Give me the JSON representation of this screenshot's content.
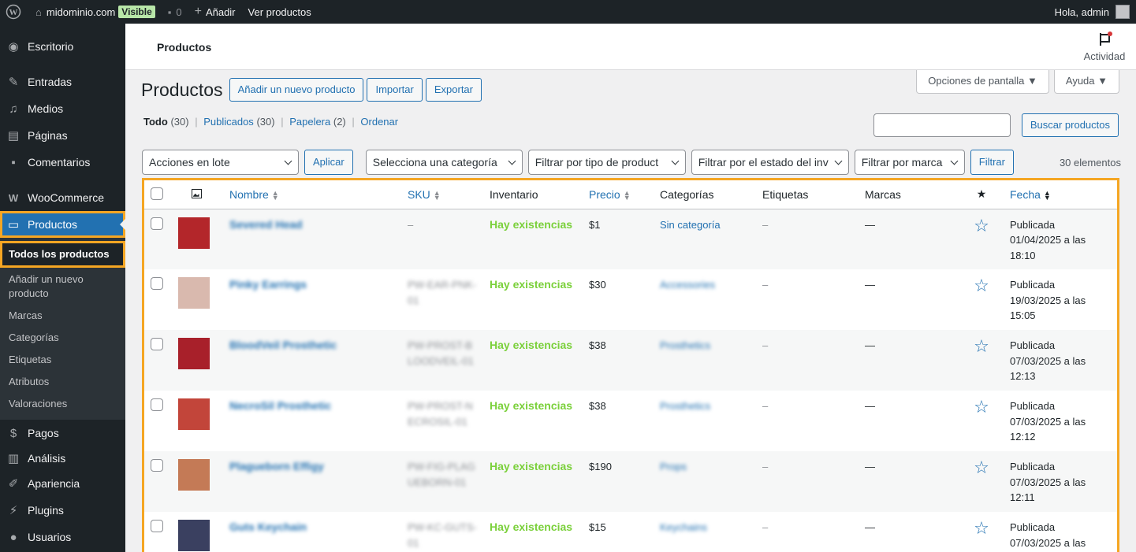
{
  "adminbar": {
    "site": "midominio.com",
    "visibility": "Visible",
    "comments_count": "0",
    "add_new": "Añadir",
    "view_products": "Ver productos",
    "greeting": "Hola, admin"
  },
  "sidebar": {
    "items": [
      {
        "label": "Escritorio",
        "icon": "dashboard-icon"
      },
      {
        "label": "Entradas",
        "icon": "pin-icon"
      },
      {
        "label": "Medios",
        "icon": "media-icon"
      },
      {
        "label": "Páginas",
        "icon": "page-icon"
      },
      {
        "label": "Comentarios",
        "icon": "comment-icon"
      },
      {
        "label": "WooCommerce",
        "icon": "woo-icon"
      },
      {
        "label": "Productos",
        "icon": "archive-icon"
      }
    ],
    "submenu": [
      "Todos los productos",
      "Añadir un nuevo producto",
      "Marcas",
      "Categorías",
      "Etiquetas",
      "Atributos",
      "Valoraciones"
    ],
    "bottom_items": [
      {
        "label": "Pagos",
        "icon": "payments-icon"
      },
      {
        "label": "Análisis",
        "icon": "chart-icon"
      },
      {
        "label": "Apariencia",
        "icon": "brush-icon"
      },
      {
        "label": "Plugins",
        "icon": "plug-icon"
      },
      {
        "label": "Usuarios",
        "icon": "user-icon"
      }
    ]
  },
  "header": {
    "title": "Productos",
    "activity": "Actividad"
  },
  "page": {
    "title": "Productos",
    "buttons": [
      "Añadir un nuevo producto",
      "Importar",
      "Exportar"
    ],
    "screen_options": "Opciones de pantalla ▼",
    "help": "Ayuda ▼",
    "views": {
      "all": "Todo",
      "all_count": "(30)",
      "published": "Publicados",
      "published_count": "(30)",
      "trash": "Papelera",
      "trash_count": "(2)",
      "sort": "Ordenar"
    },
    "search_button": "Buscar productos",
    "bulk_actions": "Acciones en lote",
    "apply": "Aplicar",
    "filters": [
      "Selecciona una categoría",
      "Filtrar por tipo de product",
      "Filtrar por el estado del inv",
      "Filtrar por marca"
    ],
    "filter_button": "Filtrar",
    "items_count": "30 elementos"
  },
  "table": {
    "columns": {
      "name": "Nombre",
      "sku": "SKU",
      "inventory": "Inventario",
      "price": "Precio",
      "categories": "Categorías",
      "tags": "Etiquetas",
      "brands": "Marcas",
      "date": "Fecha"
    },
    "rows": [
      {
        "name": "Severed Head",
        "sku": "–",
        "stock": "Hay existencias",
        "price": "$1",
        "category": "Sin categoría",
        "tags": "–",
        "brands": "—",
        "status": "Publicada",
        "date": "01/04/2025 a las",
        "time": "18:10",
        "thumb": "#b3262a"
      },
      {
        "name": "Pinky Earrings",
        "sku": "PW-EAR-PNK-01",
        "stock": "Hay existencias",
        "price": "$30",
        "category": "Accessories",
        "tags": "–",
        "brands": "—",
        "status": "Publicada",
        "date": "19/03/2025 a las",
        "time": "15:05",
        "thumb": "#d9b9ae"
      },
      {
        "name": "BloodVeil Prosthetic",
        "sku": "PW-PROST-BLOODVEIL-01",
        "stock": "Hay existencias",
        "price": "$38",
        "category": "Prosthetics",
        "tags": "–",
        "brands": "—",
        "status": "Publicada",
        "date": "07/03/2025 a las",
        "time": "12:13",
        "thumb": "#a8202a"
      },
      {
        "name": "NecroSil Prosthetic",
        "sku": "PW-PROST-NECROSIL-01",
        "stock": "Hay existencias",
        "price": "$38",
        "category": "Prosthetics",
        "tags": "–",
        "brands": "—",
        "status": "Publicada",
        "date": "07/03/2025 a las",
        "time": "12:12",
        "thumb": "#c2453a"
      },
      {
        "name": "Plagueborn Effigy",
        "sku": "PW-FIG-PLAGUEBORN-01",
        "stock": "Hay existencias",
        "price": "$190",
        "category": "Props",
        "tags": "–",
        "brands": "—",
        "status": "Publicada",
        "date": "07/03/2025 a las",
        "time": "12:11",
        "thumb": "#c47a56"
      },
      {
        "name": "Guts Keychain",
        "sku": "PW-KC-GUTS-01",
        "stock": "Hay existencias",
        "price": "$15",
        "category": "Keychains",
        "tags": "–",
        "brands": "—",
        "status": "Publicada",
        "date": "07/03/2025 a las",
        "time": "",
        "thumb": "#3a4060"
      }
    ]
  },
  "colors": {
    "accent": "#2271b1",
    "highlight": "#f5a623",
    "in_stock": "#7ad03a",
    "admin_bg": "#1d2327"
  }
}
